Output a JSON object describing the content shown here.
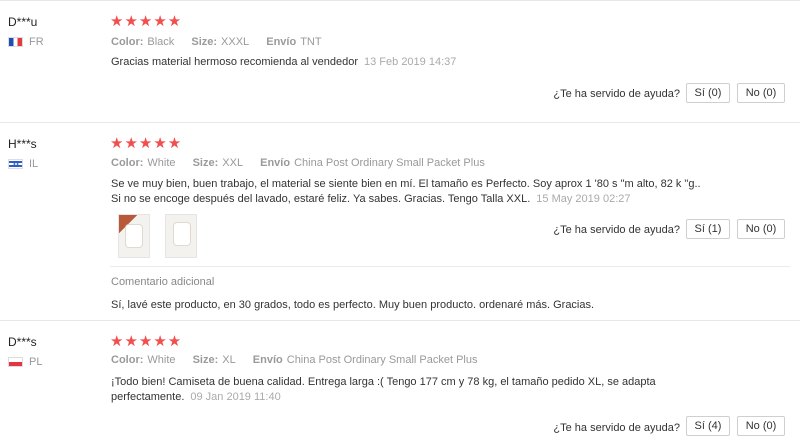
{
  "helpful_question": "¿Te ha servido de ayuda?",
  "labels": {
    "color": "Color:",
    "size": "Size:",
    "shipping": "Envío"
  },
  "reviews": [
    {
      "user": "D***u",
      "country": "FR",
      "stars": "★★★★★",
      "color": "Black",
      "size": "XXXL",
      "shipping": "TNT",
      "text": "Gracias material hermoso recomienda al vendedor",
      "date": "13 Feb 2019 14:37",
      "yes": "Sí (0)",
      "no": "No (0)"
    },
    {
      "user": "H***s",
      "country": "IL",
      "stars": "★★★★★",
      "color": "White",
      "size": "XXL",
      "shipping": "China Post Ordinary Small Packet Plus",
      "text_line1": "Se ve muy bien, buen trabajo, el material se siente bien en mí. El tamaño es Perfecto. Soy aprox 1 '80 s \"m alto, 82 k \"g..",
      "text_line2": "Si no se encoge después del lavado, estaré feliz. Ya sabes. Gracias. Tengo Talla XXL.",
      "date": "15 May 2019 02:27",
      "yes": "Sí (1)",
      "no": "No (0)",
      "additional_heading": "Comentario adicional",
      "additional_text": "Sí, lavé este producto, en 30 grados, todo es perfecto. Muy buen producto. ordenaré más. Gracias."
    },
    {
      "user": "D***s",
      "country": "PL",
      "stars": "★★★★★",
      "color": "White",
      "size": "XL",
      "shipping": "China Post Ordinary Small Packet Plus",
      "text_line1": "¡Todo bien! Camiseta de buena calidad. Entrega larga :( Tengo 177 cm y 78 kg, el tamaño pedido XL, se adapta",
      "text_line2": "perfectamente.",
      "date": "09 Jan 2019 11:40",
      "yes": "Sí (4)",
      "no": "No (0)"
    }
  ]
}
